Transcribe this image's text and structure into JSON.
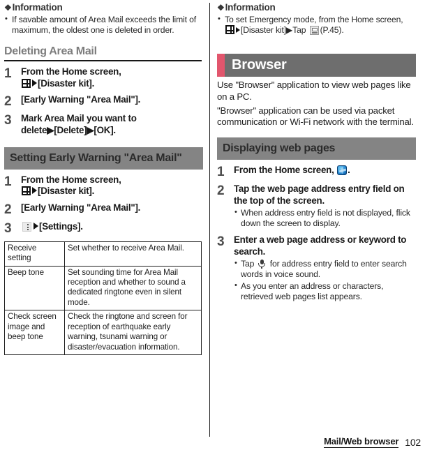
{
  "document": {
    "footer": {
      "section_label": "Mail/Web browser",
      "page_number": "102"
    }
  },
  "left_column": {
    "information": {
      "icon": "diamond-icon",
      "heading": "Information",
      "notes": [
        "If savable amount of Area Mail exceeds the limit of maximum, the oldest one is deleted in order."
      ]
    },
    "section_deleting": {
      "heading": "Deleting Area Mail",
      "steps": [
        {
          "num": "1",
          "text_before": "From the Home screen,",
          "icon": "app-grid-icon",
          "text_after": "[Disaster kit]."
        },
        {
          "num": "2",
          "text": "[Early Warning \"Area Mail\"]."
        },
        {
          "num": "3",
          "text": "Mark Area Mail you want to delete▶[Delete]▶[OK]."
        }
      ]
    },
    "section_setting": {
      "heading": "Setting Early Warning \"Area Mail\"",
      "steps": [
        {
          "num": "1",
          "text_before": "From the Home screen,",
          "icon": "app-grid-icon",
          "text_after": "[Disaster kit]."
        },
        {
          "num": "2",
          "text": "[Early Warning \"Area Mail\"]."
        },
        {
          "num": "3",
          "icon": "overflow-menu-icon",
          "text_after": "[Settings]."
        }
      ],
      "table": {
        "rows": [
          {
            "key": "Receive setting",
            "value": "Set whether to receive Area Mail."
          },
          {
            "key": "Beep tone",
            "value": "Set sounding time for Area Mail reception and whether to sound a dedicated ringtone even in silent mode."
          },
          {
            "key": "Check screen image and beep tone",
            "value": "Check the ringtone and screen for reception of earthquake early warning, tsunami warning or disaster/evacuation information."
          }
        ]
      }
    }
  },
  "right_column": {
    "information": {
      "icon": "diamond-icon",
      "heading": "Information",
      "note_parts": {
        "before": "To set Emergency mode, from the Home screen,",
        "after_grid": "[Disaster kit]▶Tap",
        "after_app": "(P.45)."
      }
    },
    "chapter": {
      "title": "Browser",
      "accent_color": "#e2566d",
      "bar_color": "#6e6e6e"
    },
    "intro_paragraphs": [
      "Use \"Browser\" application to view web pages like on a PC.",
      "\"Browser\" application can be used via packet communication or Wi-Fi network with the terminal."
    ],
    "section_displaying": {
      "heading": "Displaying web pages",
      "steps": [
        {
          "num": "1",
          "text_before": "From the Home screen,",
          "icon": "browser-globe-icon",
          "text_after": "."
        },
        {
          "num": "2",
          "text": "Tap the web page address entry field on the top of the screen.",
          "subnotes": [
            "When address entry field is not displayed, flick down the screen to display."
          ]
        },
        {
          "num": "3",
          "text": "Enter a web page address or keyword to search.",
          "subnote_mic_before": "Tap",
          "subnote_mic_after": "for address entry field to enter search words in voice sound.",
          "subnotes": [
            "As you enter an address or characters, retrieved web pages list appears."
          ]
        }
      ]
    }
  }
}
